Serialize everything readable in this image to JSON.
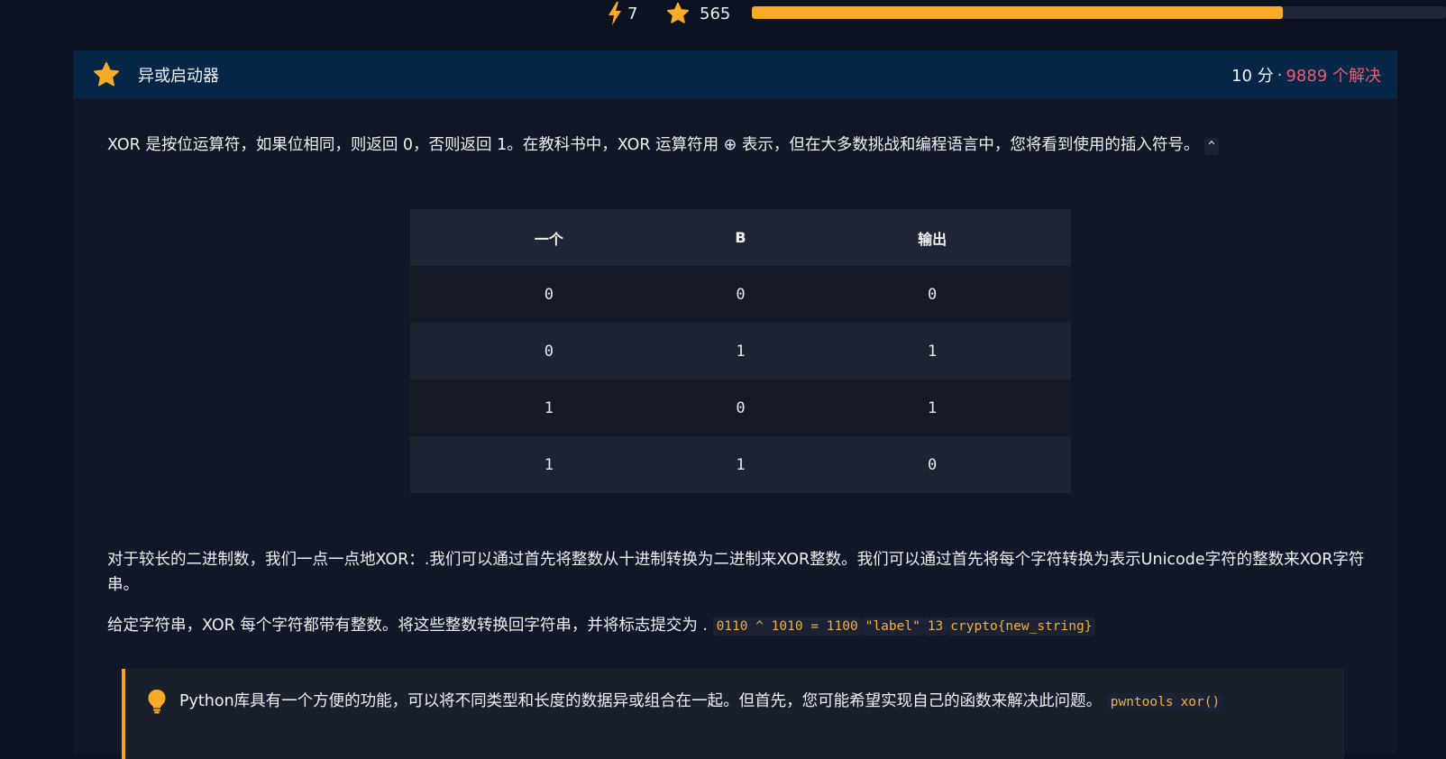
{
  "topbar": {
    "energy": "7",
    "points": "565",
    "progress_fraction": 0.765,
    "icons": {
      "energy": "lightning-icon",
      "points": "star-icon"
    },
    "colors": {
      "accent": "#f7ab26"
    }
  },
  "challenge": {
    "title": "异或启动器",
    "points_text": "10 分",
    "separator": "·",
    "solves_text": "9889 个解决",
    "icon": "star-icon",
    "colors": {
      "header_bg": "#062648",
      "solves": "#ef5a6f"
    }
  },
  "content": {
    "intro_text": "XOR 是按位运算符，如果位相同，则返回 0，否则返回 1。在教科书中，XOR 运算符用 ⊕ 表示，但在大多数挑战和编程语言中，您将看到使用的插入符号。",
    "intro_code": "^",
    "table": {
      "headers": [
        "一个",
        "B",
        "输出"
      ],
      "rows": [
        [
          "0",
          "0",
          "0"
        ],
        [
          "0",
          "1",
          "1"
        ],
        [
          "1",
          "0",
          "1"
        ],
        [
          "1",
          "1",
          "0"
        ]
      ]
    },
    "para2": "对于较长的二进制数，我们一点一点地XOR：.我们可以通过首先将整数从十进制转换为二进制来XOR整数。我们可以通过首先将每个字符转换为表示Unicode字符的整数来XOR字符串。",
    "para3_text": "给定字符串，XOR 每个字符都带有整数。将这些整数转换回字符串，并将标志提交为 .",
    "para3_codes": [
      "0110 ^ 1010 = 1100",
      "\"label\"",
      "13",
      "crypto{new_string}"
    ],
    "hint_text": "Python库具有一个方便的功能，可以将不同类型和长度的数据异或组合在一起。但首先，您可能希望实现自己的函数来解决此问题。",
    "hint_codes": [
      "pwntools",
      "xor()"
    ],
    "hint_icon": "lightbulb-icon"
  }
}
